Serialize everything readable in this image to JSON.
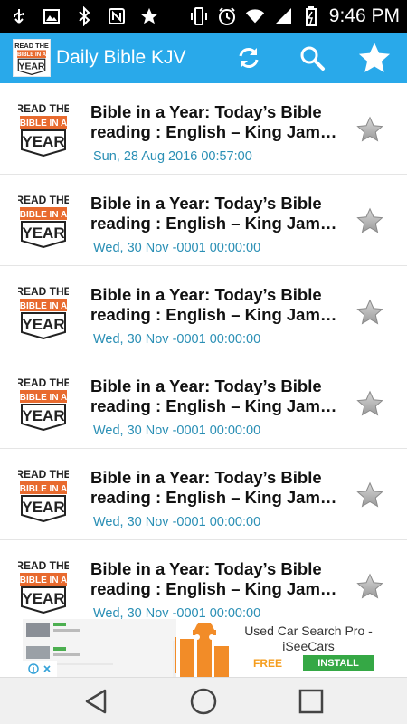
{
  "status_bar": {
    "time": "9:46 PM",
    "icons": [
      "usb-icon",
      "photo-icon",
      "bluetooth-icon",
      "nfc-icon",
      "star-icon",
      "vibrate-icon",
      "alarm-icon",
      "wifi-icon",
      "signal-icon",
      "battery-icon"
    ]
  },
  "app_bar": {
    "title": "Daily Bible KJV",
    "logo_text": [
      "READ THE",
      "BIBLE IN A",
      "YEAR"
    ],
    "actions": [
      "refresh-icon",
      "search-icon",
      "favorites-star-icon"
    ]
  },
  "colors": {
    "accent": "#29a9ea",
    "date": "#2a8fb5",
    "logo_orange": "#e86a2e"
  },
  "feed": {
    "items": [
      {
        "title_line1": "Bible in a Year: Today’s Bible",
        "title_line2": "reading : English –  King James Version",
        "date": "Sun, 28 Aug 2016 00:57:00"
      },
      {
        "title_line1": "Bible in a Year: Today’s Bible",
        "title_line2": "reading : English –  King James Version",
        "date": "Wed, 30 Nov -0001 00:00:00"
      },
      {
        "title_line1": "Bible in a Year: Today’s Bible",
        "title_line2": "reading : English –  King James Version",
        "date": "Wed, 30 Nov -0001 00:00:00"
      },
      {
        "title_line1": "Bible in a Year: Today’s Bible",
        "title_line2": "reading : English –  King James Version",
        "date": "Wed, 30 Nov -0001 00:00:00"
      },
      {
        "title_line1": "Bible in a Year: Today’s Bible",
        "title_line2": "reading : English –  King James Version",
        "date": "Wed, 30 Nov -0001 00:00:00"
      },
      {
        "title_line1": "Bible in a Year: Today’s Bible",
        "title_line2": "reading : English –  King James Version",
        "date": "Wed, 30 Nov -0001 00:00:00"
      }
    ]
  },
  "ad": {
    "title": "Used Car Search Pro - iSeeCars",
    "free_label": "FREE",
    "install_label": "INSTALL"
  },
  "nav_bar": {
    "buttons": [
      "back-icon",
      "home-icon",
      "recents-icon"
    ]
  }
}
